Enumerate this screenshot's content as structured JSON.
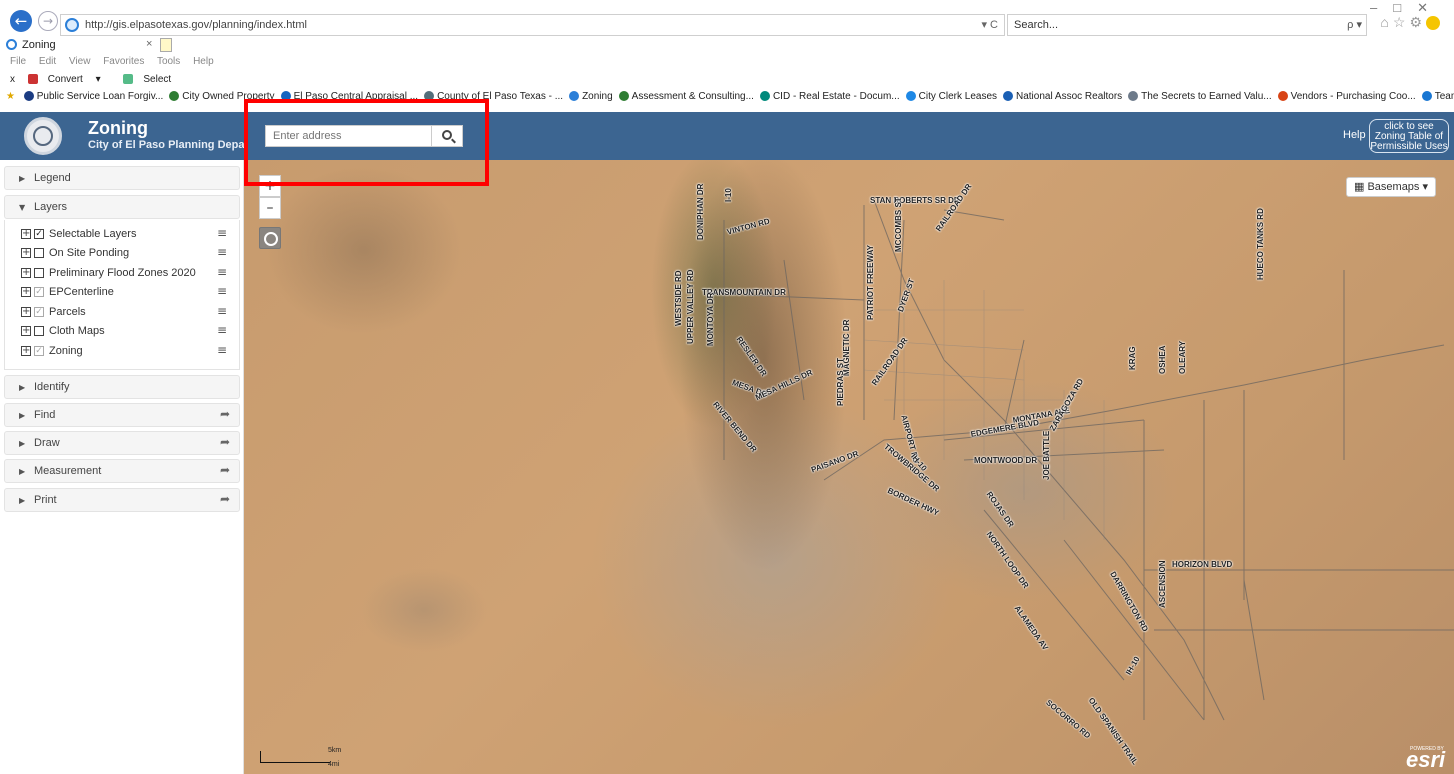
{
  "browser": {
    "url": "http://gis.elpasotexas.gov/planning/index.html",
    "url_controls": "▾ C",
    "search_placeholder": "Search...",
    "search_controls": "ρ ▾",
    "tab_title": "Zoning",
    "tab_close": "×",
    "menu": [
      "File",
      "Edit",
      "View",
      "Favorites",
      "Tools",
      "Help"
    ],
    "commands": {
      "close": "x",
      "convert": "Convert",
      "convert_caret": "▾",
      "select": "Select"
    },
    "favorites": [
      {
        "label": "Public Service Loan Forgiv...",
        "color": "#1b3c82"
      },
      {
        "label": "City Owned Property",
        "color": "#2e7d32"
      },
      {
        "label": "El Paso Central Appraisal ...",
        "color": "#1565c0"
      },
      {
        "label": "County of El Paso Texas - ...",
        "color": "#546e7a"
      },
      {
        "label": "Zoning",
        "color": "#2b7fd8"
      },
      {
        "label": "Assessment & Consulting...",
        "color": "#2e7d32"
      },
      {
        "label": "CID - Real Estate - Docum...",
        "color": "#00897b"
      },
      {
        "label": "City Clerk Leases",
        "color": "#1e88e5"
      },
      {
        "label": "National Assoc Realtors",
        "color": "#1a5fb4"
      },
      {
        "label": "The Secrets to Earned Valu...",
        "color": "#6d7a8a"
      },
      {
        "label": "Vendors - Purchasing Coo...",
        "color": "#d84315"
      },
      {
        "label": "TeamViewer",
        "color": "#1976d2"
      }
    ]
  },
  "header": {
    "title": "Zoning",
    "subtitle": "City of El Paso Planning Department",
    "address_placeholder": "Enter address",
    "help": "Help",
    "zoning_table_button": [
      "click to see",
      "Zoning Table of",
      "Permissible Uses"
    ]
  },
  "sidebar": {
    "legend": "Legend",
    "layers": "Layers",
    "layer_items": [
      {
        "name": "Selectable Layers",
        "checked": true
      },
      {
        "name": "On Site Ponding",
        "checked": false
      },
      {
        "name": "Preliminary Flood Zones 2020",
        "checked": false
      },
      {
        "name": "EPCenterline",
        "checked": true,
        "dim": true
      },
      {
        "name": "Parcels",
        "checked": true,
        "dim": true
      },
      {
        "name": "Cloth Maps",
        "checked": false
      },
      {
        "name": "Zoning",
        "checked": true,
        "dim": true
      }
    ],
    "tools": [
      "Identify",
      "Find",
      "Draw",
      "Measurement",
      "Print"
    ],
    "collapse_icon": "‹"
  },
  "map": {
    "zoom_in": "+",
    "zoom_out": "–",
    "basemaps": "Basemaps ▾",
    "scale_km": "5km",
    "scale_mi": "4mi",
    "esri": "esri",
    "powered_by": "POWERED BY",
    "road_labels": [
      "STAN ROBERTS SR DR",
      "I-10",
      "DONIPHAN DR",
      "VINTON RD",
      "TRANSMOUNTAIN DR",
      "MCCOMBS ST",
      "RAILROAD DR",
      "PATRIOT FREEWAY",
      "DYER ST",
      "WESTSIDE RD",
      "UPPER VALLEY RD",
      "MONTOYA DR",
      "RESLER DR",
      "MESA DR",
      "RIVER BEND DR",
      "MESA HILLS DR",
      "MAGNETIC DR",
      "PIEDRAS ST",
      "RAILROAD DR",
      "AIRPORT RD",
      "MONTANA AVE",
      "EDGEMERE BLVD",
      "ZARAGOZA RD",
      "TROWBRIDGE DR",
      "IH-10",
      "MONTWOOD DR",
      "PAISANO DR",
      "BORDER HWY",
      "ROJAS DR",
      "JOE BATTLE",
      "NORTH LOOP DR",
      "KRAG",
      "OSHEA",
      "OLEARY",
      "HUECO TANKS RD",
      "HORIZON BLVD",
      "DARRINGTON RD",
      "ASCENSION",
      "ALAMEDA AV",
      "IH-10",
      "SOCORRO RD",
      "OLD SPANISH TRAIL"
    ]
  }
}
